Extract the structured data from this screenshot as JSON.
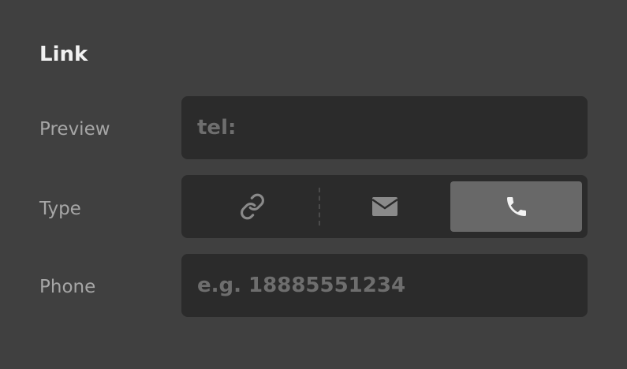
{
  "panel": {
    "title": "Link"
  },
  "preview": {
    "label": "Preview",
    "value": "tel:"
  },
  "type": {
    "label": "Type",
    "options": [
      {
        "icon": "link-icon",
        "selected": false
      },
      {
        "icon": "mail-icon",
        "selected": false
      },
      {
        "icon": "phone-icon",
        "selected": true
      }
    ]
  },
  "phone": {
    "label": "Phone",
    "placeholder": "e.g. 18885551234",
    "value": ""
  },
  "colors": {
    "background": "#404040",
    "field": "#2b2b2b",
    "selected_segment": "#686868",
    "label": "#a6a6a6",
    "title": "#f2f2f2",
    "muted_text": "#6e6e6e"
  }
}
